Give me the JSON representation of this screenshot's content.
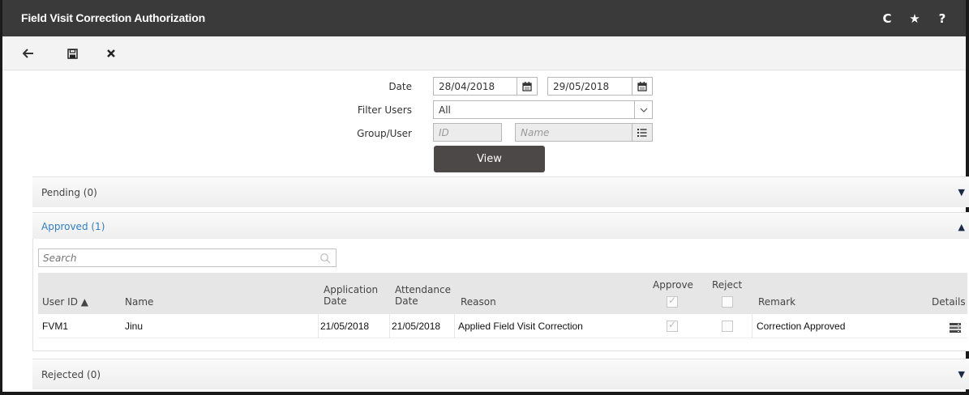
{
  "window": {
    "title": "Field Visit Correction Authorization",
    "title_icons": [
      "refresh-icon",
      "star-icon",
      "help-icon"
    ],
    "refresh_glyph": "C",
    "star_glyph": "★",
    "help_glyph": "?"
  },
  "toolbar": {
    "back_glyph": "←",
    "save_glyph": "🖫",
    "close_glyph": "✖"
  },
  "filters": {
    "date_label": "Date",
    "date_from": "28/04/2018",
    "date_to": "29/05/2018",
    "filter_users_label": "Filter Users",
    "filter_users_value": "All",
    "group_user_label": "Group/User",
    "id_placeholder": "ID",
    "name_placeholder": "Name",
    "view_button": "View"
  },
  "sections": {
    "pending": "Pending (0)",
    "approved": "Approved (1)",
    "rejected": "Rejected (0)"
  },
  "approved": {
    "search_placeholder": "Search",
    "columns": {
      "user_id": "User ID ▲",
      "name": "Name",
      "application_date_1": "Application",
      "application_date_2": "Date",
      "attendance_date_1": "Attendance",
      "attendance_date_2": "Date",
      "reason": "Reason",
      "approve": "Approve",
      "reject": "Reject",
      "remark": "Remark",
      "details": "Details"
    },
    "rows": [
      {
        "user_id": "FVM1",
        "name": "Jinu",
        "application_date": "21/05/2018",
        "attendance_date": "21/05/2018",
        "reason": "Applied Field Visit Correction",
        "approve": true,
        "reject": false,
        "remark": "Correction Approved"
      }
    ]
  },
  "colors": {
    "titlebar": "#3a3a3a",
    "accent_blue": "#2f7ec4",
    "view_button": "#4d4848"
  }
}
